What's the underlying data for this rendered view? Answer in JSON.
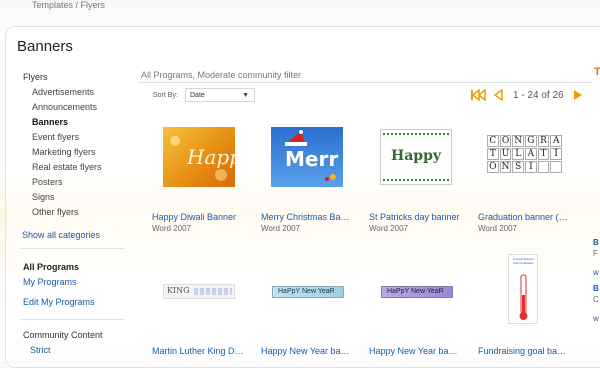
{
  "breadcrumb": "Templates / Flyers",
  "page_title": "Banners",
  "sidebar": {
    "heading": "Flyers",
    "items": [
      "Advertisements",
      "Announcements",
      "Banners",
      "Event flyers",
      "Marketing flyers",
      "Real estate flyers",
      "Posters",
      "Signs",
      "Other flyers"
    ],
    "show_all": "Show all categories",
    "programs_heading": "All Programs",
    "programs_links": [
      "My Programs",
      "Edit My Programs"
    ],
    "community_heading": "Community Content",
    "community_option": "Strict"
  },
  "filter": {
    "text": "All Programs, Moderate community filter",
    "right_letter": "T"
  },
  "sort": {
    "label": "Sort By:",
    "value": "Date"
  },
  "pager": {
    "text": "1 - 24 of 26"
  },
  "cards_row1": [
    {
      "title": "Happy Diwali Banner",
      "subtitle": "Word 2007",
      "thumb_text": "Happ"
    },
    {
      "title": "Merry Christmas Ba…",
      "subtitle": "Word 2007",
      "thumb_text": "Merr"
    },
    {
      "title": "St Patricks day banner",
      "subtitle": "Word 2007",
      "thumb_text": "Happy"
    },
    {
      "title": "Graduation banner (…",
      "subtitle": "Word 2007",
      "thumb_rows": [
        "CONGRA",
        "TULATI",
        "ONSI"
      ]
    }
  ],
  "cards_row2": [
    {
      "title": "Martin Luther King D…",
      "thumb_text": "KING"
    },
    {
      "title": "Happy New Year ba…",
      "thumb_text": "HaPpY New YeaR"
    },
    {
      "title": "Happy New Year ba…",
      "thumb_text": "HaPpY New YeaR"
    },
    {
      "title": "Fundraising goal ba…",
      "thumb_text": "Annual Science Fair Fundraiser"
    }
  ],
  "right_clips": [
    "B",
    "F",
    "w",
    "B",
    "C",
    "w"
  ],
  "colors": {
    "link": "#1a5aa6",
    "accent": "#e36b1a",
    "pager": "#e8a200"
  }
}
